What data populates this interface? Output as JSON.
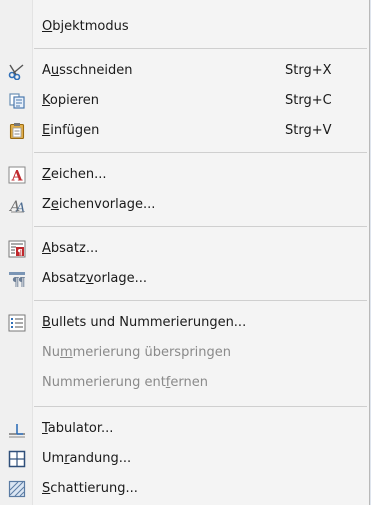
{
  "menu": {
    "objektmodus": {
      "pre": "",
      "u": "O",
      "post": "bjektmodus"
    },
    "ausschneiden": {
      "pre": "A",
      "u": "u",
      "post": "sschneiden",
      "shortcut": "Strg+X",
      "icon": "scissors-icon"
    },
    "kopieren": {
      "pre": "",
      "u": "K",
      "post": "opieren",
      "shortcut": "Strg+C",
      "icon": "copy-icon"
    },
    "einfuegen": {
      "pre": "",
      "u": "E",
      "post": "infügen",
      "shortcut": "Strg+V",
      "icon": "paste-icon"
    },
    "zeichen": {
      "pre": "",
      "u": "Z",
      "post": "eichen...",
      "icon": "character-icon"
    },
    "zeichenvorlage": {
      "pre": "Z",
      "u": "e",
      "post": "ichenvorlage...",
      "icon": "character-style-icon"
    },
    "absatz": {
      "pre": "",
      "u": "A",
      "post": "bsatz...",
      "icon": "paragraph-icon"
    },
    "absatzvorlage": {
      "pre": "Absatz",
      "u": "v",
      "post": "orlage...",
      "icon": "paragraph-style-icon"
    },
    "bullets": {
      "pre": "",
      "u": "B",
      "post": "ullets und Nummerierungen...",
      "icon": "bullets-icon"
    },
    "nummerierung_ueberspringen": {
      "pre": "Nu",
      "u": "m",
      "post": "merierung überspringen"
    },
    "nummerierung_entfernen": {
      "pre": "Nummerierung ent",
      "u": "f",
      "post": "ernen"
    },
    "tabulator": {
      "pre": "",
      "u": "T",
      "post": "abulator...",
      "icon": "tab-icon"
    },
    "umrandung": {
      "pre": "Um",
      "u": "r",
      "post": "andung...",
      "icon": "border-icon"
    },
    "schattierung": {
      "pre": "",
      "u": "S",
      "post": "chattierung...",
      "icon": "shading-icon"
    }
  },
  "colors": {
    "accent": "#4a90d9",
    "menu_bg": "#f4f4f4",
    "disabled": "#8a8a8a"
  }
}
